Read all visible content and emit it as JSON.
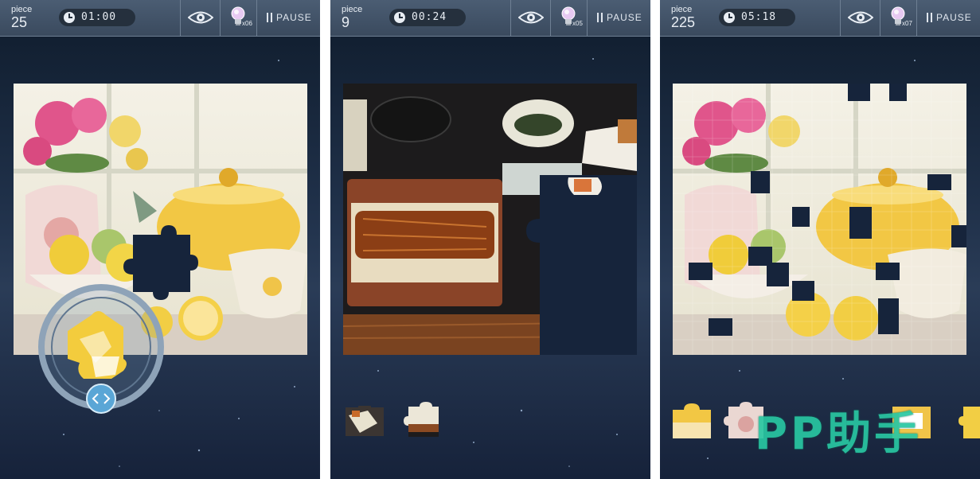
{
  "screens": [
    {
      "piece_label": "piece",
      "piece_count": "25",
      "timer": "01:00",
      "hint_count": "x06",
      "pause_label": "PAUSE",
      "image": "tea-set-with-flowers-and-lemons"
    },
    {
      "piece_label": "piece",
      "piece_count": "9",
      "timer": "00:24",
      "hint_count": "x05",
      "pause_label": "PAUSE",
      "image": "unagi-don-meal-tray"
    },
    {
      "piece_label": "piece",
      "piece_count": "225",
      "timer": "05:18",
      "hint_count": "x07",
      "pause_label": "PAUSE",
      "image": "tea-set-with-flowers-and-lemons"
    }
  ],
  "icons": {
    "clock": "clock-icon",
    "preview": "eye-icon",
    "hint": "lightbulb-icon",
    "pause": "pause-icon",
    "rotate": "rotate-arrows-icon"
  },
  "colors": {
    "background_top": "#0f1c2c",
    "toolbar": "#3a4a5e",
    "empty_slot": "#16243b",
    "watermark": "#29c7a2"
  },
  "watermark": "PP助手"
}
